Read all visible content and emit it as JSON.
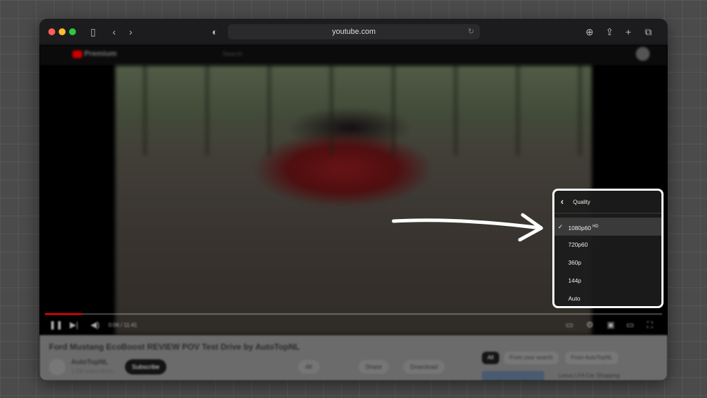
{
  "browser": {
    "url": "youtube.com",
    "traffic_lights": [
      "#ff5f57",
      "#febc2e",
      "#28c840"
    ]
  },
  "youtube": {
    "logo_text": "Premium",
    "search_placeholder": "Search"
  },
  "video": {
    "progress_percent": 6,
    "time": "0:06 / 11:41"
  },
  "info": {
    "title": "Ford Mustang EcoBoost REVIEW POV Test Drive by AutoTopNL",
    "channel": "AutoTopNL",
    "subscribers": "1.5M subscribers",
    "subscribe": "Subscribe",
    "likes": "4K",
    "share": "Share",
    "download": "Download",
    "chips": [
      "All",
      "From your search",
      "From AutoTopNL"
    ],
    "related_title": "Lexus LFA Car Shopping"
  },
  "quality_menu": {
    "title": "Quality",
    "items": [
      {
        "label": "1080p60",
        "badge": "HD",
        "selected": true
      },
      {
        "label": "720p60"
      },
      {
        "label": "360p"
      },
      {
        "label": "144p"
      },
      {
        "label": "Auto"
      }
    ]
  },
  "colors": {
    "accent": "#ff0000",
    "menu_border": "#ffffff"
  }
}
